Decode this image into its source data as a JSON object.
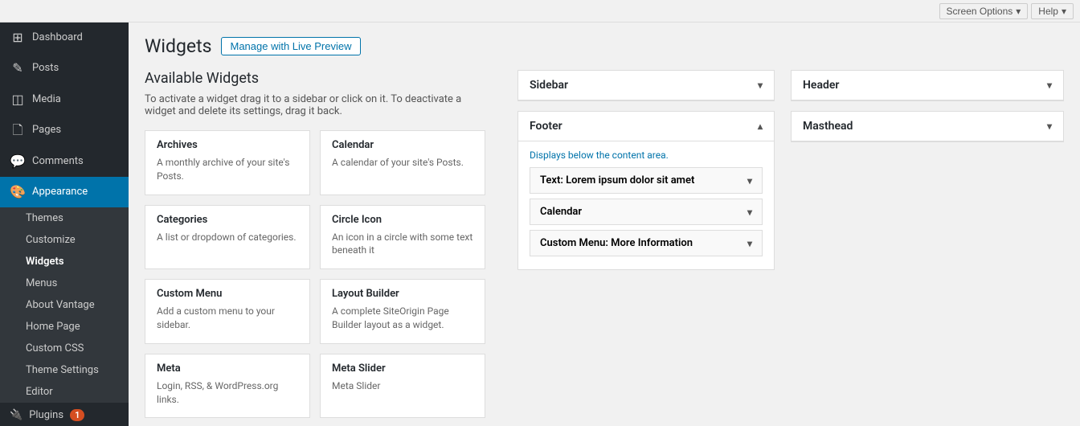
{
  "topbar": {
    "screen_options_label": "Screen Options",
    "help_label": "Help",
    "chevron": "▾"
  },
  "sidebar": {
    "items": [
      {
        "id": "dashboard",
        "label": "Dashboard",
        "icon": "⊞"
      },
      {
        "id": "posts",
        "label": "Posts",
        "icon": "✎"
      },
      {
        "id": "media",
        "label": "Media",
        "icon": "🖼"
      },
      {
        "id": "pages",
        "label": "Pages",
        "icon": "📄"
      },
      {
        "id": "comments",
        "label": "Comments",
        "icon": "💬"
      },
      {
        "id": "appearance",
        "label": "Appearance",
        "icon": "🎨",
        "active": true
      }
    ],
    "appearance_sub": [
      {
        "id": "themes",
        "label": "Themes"
      },
      {
        "id": "customize",
        "label": "Customize"
      },
      {
        "id": "widgets",
        "label": "Widgets",
        "active": true
      },
      {
        "id": "menus",
        "label": "Menus"
      },
      {
        "id": "about-vantage",
        "label": "About Vantage"
      },
      {
        "id": "home-page",
        "label": "Home Page"
      },
      {
        "id": "custom-css",
        "label": "Custom CSS"
      },
      {
        "id": "theme-settings",
        "label": "Theme Settings"
      },
      {
        "id": "editor",
        "label": "Editor"
      }
    ],
    "plugins": {
      "label": "Plugins",
      "icon": "🔌",
      "badge": "1"
    }
  },
  "page": {
    "title": "Widgets",
    "manage_btn": "Manage with Live Preview"
  },
  "available_widgets": {
    "section_title": "Available Widgets",
    "section_desc": "To activate a widget drag it to a sidebar or click on it. To deactivate a widget and delete its settings, drag it back.",
    "widgets": [
      {
        "title": "Archives",
        "desc": "A monthly archive of your site's Posts."
      },
      {
        "title": "Calendar",
        "desc": "A calendar of your site's Posts."
      },
      {
        "title": "Categories",
        "desc": "A list or dropdown of categories."
      },
      {
        "title": "Circle Icon",
        "desc": "An icon in a circle with some text beneath it"
      },
      {
        "title": "Custom Menu",
        "desc": "Add a custom menu to your sidebar."
      },
      {
        "title": "Layout Builder",
        "desc": "A complete SiteOrigin Page Builder layout as a widget."
      },
      {
        "title": "Meta",
        "desc": "Login, RSS, & WordPress.org links."
      },
      {
        "title": "Meta Slider",
        "desc": "Meta Slider"
      }
    ]
  },
  "sidebar_panel": {
    "title": "Sidebar",
    "chevron_collapsed": "▾"
  },
  "footer_panel": {
    "title": "Footer",
    "chevron_expanded": "▴",
    "desc": "Displays below the content area.",
    "widgets": [
      {
        "label": "Text: Lorem ipsum dolor sit amet"
      },
      {
        "label": "Calendar"
      },
      {
        "label": "Custom Menu: More Information"
      }
    ]
  },
  "header_panel": {
    "title": "Header",
    "chevron": "▾"
  },
  "masthead_panel": {
    "title": "Masthead",
    "chevron": "▾"
  }
}
